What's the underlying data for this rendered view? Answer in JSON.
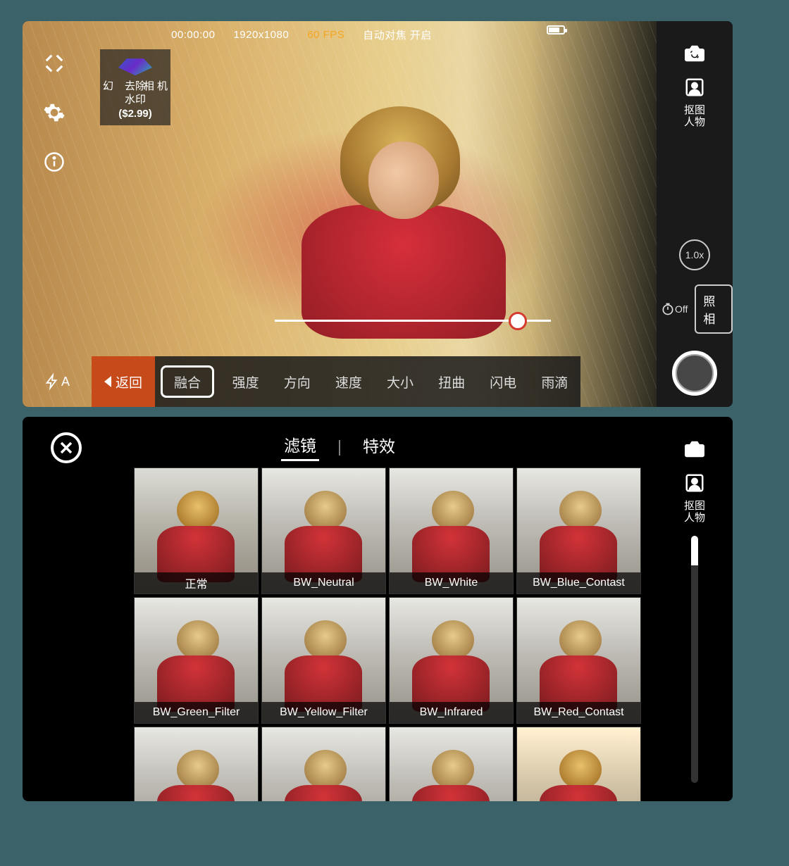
{
  "status": {
    "timecode": "00:00:00",
    "resolution": "1920x1080",
    "fps": "60 FPS",
    "autofocus": "自动对焦 开启"
  },
  "watermark": {
    "line1": "去除",
    "line2": "水印",
    "brand_l": "幻",
    "brand_r": "相 机",
    "price": "($2.99)"
  },
  "right": {
    "cutout_l1": "抠图",
    "cutout_l2": "人物",
    "zoom": "1.0x",
    "timer": "Off",
    "mode_label": "照相"
  },
  "flash_mode": "A",
  "back_label": "返回",
  "params": [
    "融合",
    "强度",
    "方向",
    "速度",
    "大小",
    "扭曲",
    "闪电",
    "雨滴"
  ],
  "bottom_tabs": {
    "filter": "滤镜",
    "effect": "特效",
    "sep": "|"
  },
  "right2": {
    "cutout_l1": "抠图",
    "cutout_l2": "人物"
  },
  "filters": [
    {
      "label": "正常",
      "cls": "f-normal"
    },
    {
      "label": "BW_Neutral",
      "cls": "f-bw"
    },
    {
      "label": "BW_White",
      "cls": "f-bw"
    },
    {
      "label": "BW_Blue_Contast",
      "cls": "f-bw"
    },
    {
      "label": "BW_Green_Filter",
      "cls": "f-bw"
    },
    {
      "label": "BW_Yellow_Filter",
      "cls": "f-bw"
    },
    {
      "label": "BW_Infrared",
      "cls": "f-bw"
    },
    {
      "label": "BW_Red_Contast",
      "cls": "f-bw"
    },
    {
      "label": "",
      "cls": "f-bw"
    },
    {
      "label": "",
      "cls": "f-bw"
    },
    {
      "label": "",
      "cls": "f-bw"
    },
    {
      "label": "",
      "cls": "f-sep"
    }
  ]
}
